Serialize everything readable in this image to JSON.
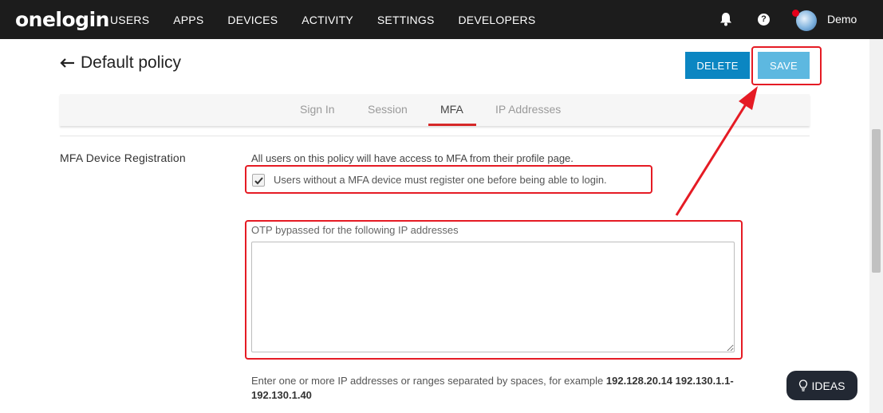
{
  "header": {
    "logo": "onelogin",
    "nav": [
      "USERS",
      "APPS",
      "DEVICES",
      "ACTIVITY",
      "SETTINGS",
      "DEVELOPERS"
    ],
    "help_glyph": "?",
    "user_name": "Demo",
    "icons": [
      "bell-icon",
      "help-icon",
      "avatar"
    ]
  },
  "page": {
    "title": "Default policy",
    "delete_label": "DELETE",
    "save_label": "SAVE"
  },
  "tabs": [
    "Sign In",
    "Session",
    "MFA",
    "IP Addresses"
  ],
  "active_tab": "MFA",
  "mfa": {
    "section_label": "MFA Device Registration",
    "description": "All users on this policy will have access to MFA from their profile page.",
    "checkbox_label": "Users without a MFA device must register one before being able to login.",
    "checkbox_checked": true,
    "otp_label": "OTP bypassed for the following IP addresses",
    "otp_value": "",
    "help_text_prefix": "Enter one or more IP addresses or ranges separated by spaces, for example ",
    "help_text_example": "192.128.20.14 192.130.1.1-192.130.1.40"
  },
  "ideas_label": "IDEAS",
  "colors": {
    "topbar": "#1c1c1c",
    "delete": "#0b86c2",
    "save": "#5db8e0",
    "highlight": "#e51b24",
    "tab_active": "#d62828"
  }
}
